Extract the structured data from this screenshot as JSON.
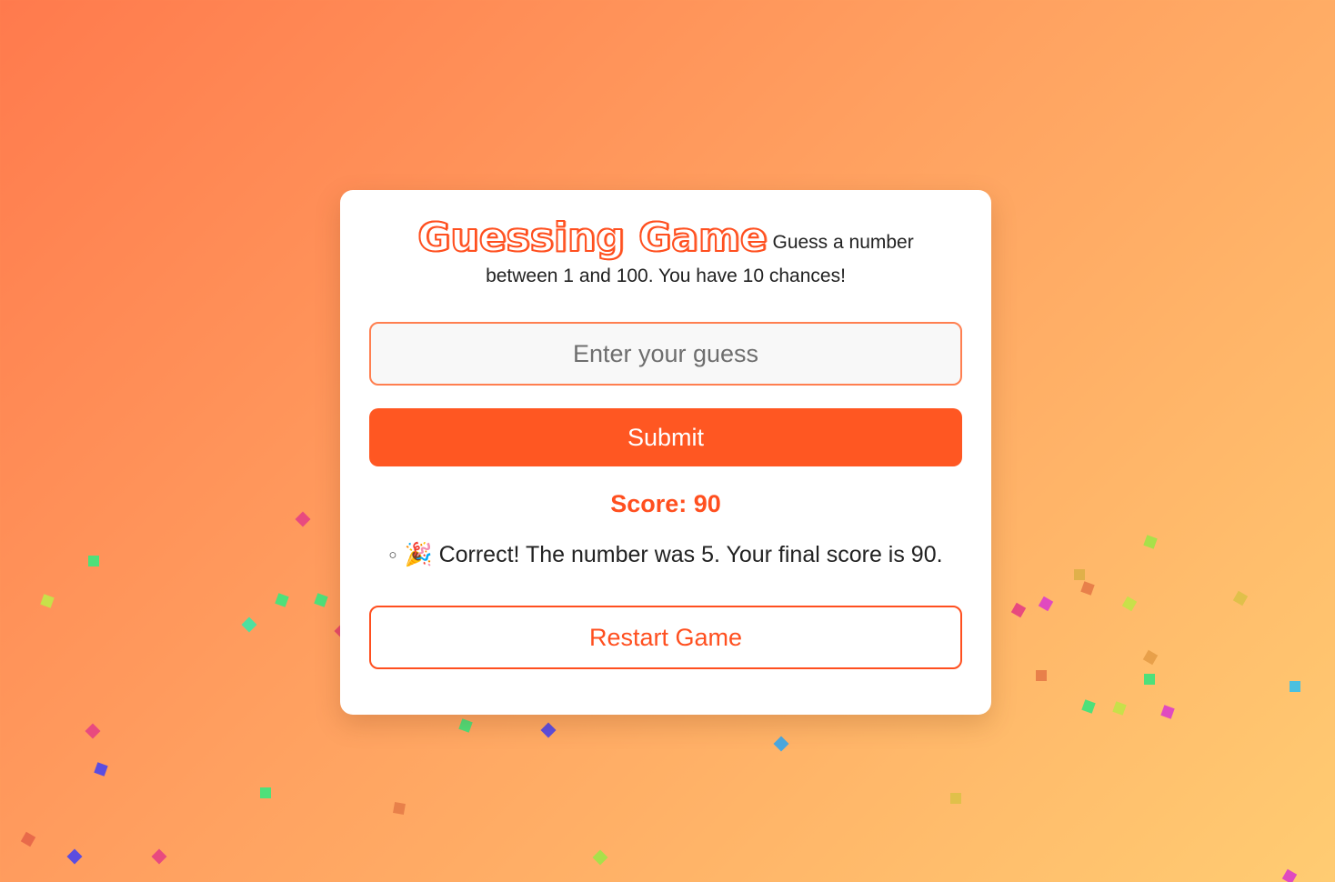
{
  "game": {
    "title": "Guessing Game",
    "instructions": "Guess a number between 1 and 100. You have 10 chances!",
    "input_placeholder": "Enter your guess",
    "submit_label": "Submit",
    "score_text": "Score: 90",
    "message_emoji": "🎉",
    "message_text": " Correct! The number was 5. Your final score is 90.",
    "restart_label": "Restart Game"
  },
  "colors": {
    "accent": "#ff5722",
    "title_outline": "#ff4f1f",
    "input_border": "#ff7f50",
    "background_start": "#ff7a4d",
    "background_end": "#ffcc72"
  }
}
